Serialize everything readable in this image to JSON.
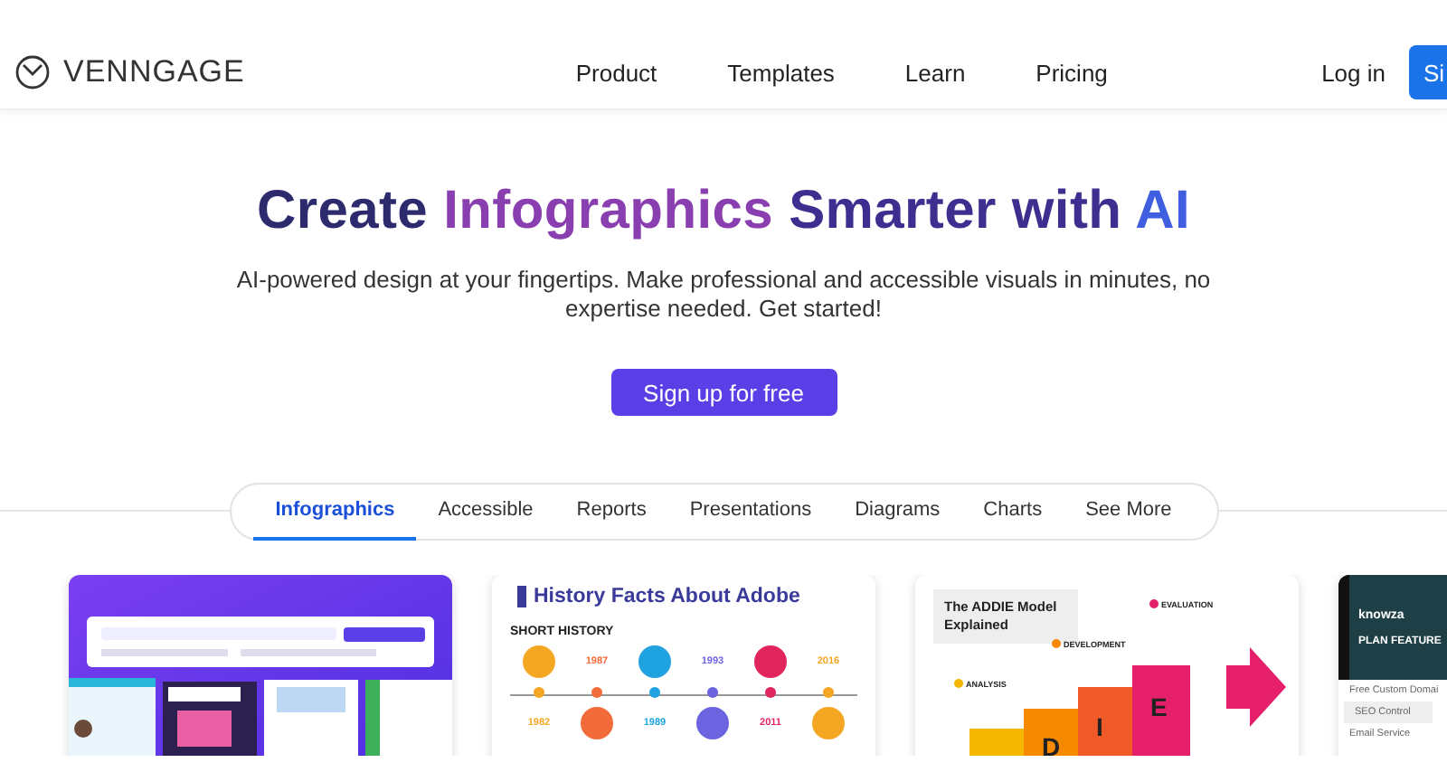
{
  "nav": {
    "logo": "VENNGAGE",
    "links": [
      "Product",
      "Templates",
      "Learn",
      "Pricing"
    ],
    "login": "Log in",
    "signup": "Si"
  },
  "hero": {
    "title": [
      {
        "text": "Create ",
        "color": "#2d2a6e"
      },
      {
        "text": "Infographics",
        "color": "#8a3fb0"
      },
      {
        "text": " Smarter with ",
        "color": "#3d2f8f"
      },
      {
        "text": "AI",
        "color": "#3f5fe0"
      }
    ],
    "subtitle": "AI-powered design at your fingertips. Make professional and accessible visuals in minutes, no expertise needed. Get started!",
    "button": "Sign up for free"
  },
  "tabs": [
    {
      "label": "Infographics",
      "selected": true
    },
    {
      "label": "Accessible",
      "selected": false
    },
    {
      "label": "Reports",
      "selected": false
    },
    {
      "label": "Presentations",
      "selected": false
    },
    {
      "label": "Diagrams",
      "selected": false
    },
    {
      "label": "Charts",
      "selected": false
    },
    {
      "label": "See More",
      "selected": false
    }
  ],
  "templates": [
    {
      "kind": "ai-builder"
    },
    {
      "kind": "timeline",
      "title": "History Facts About Adobe",
      "section": "SHORT HISTORY",
      "events": [
        {
          "year": "1982",
          "color": "#f5a623"
        },
        {
          "year": "1987",
          "color": "#f26b3a"
        },
        {
          "year": "1989",
          "color": "#1fa3e0"
        },
        {
          "year": "1993",
          "color": "#6c63e0"
        },
        {
          "year": "2011",
          "color": "#e0245e"
        },
        {
          "year": "2016",
          "color": "#f5a623"
        }
      ]
    },
    {
      "kind": "addie",
      "title": "The ADDIE Model Explained",
      "steps": [
        "ANALYSIS",
        "DEVELOPMENT",
        "EVALUATION"
      ],
      "letters": [
        "D",
        "I",
        "E"
      ]
    },
    {
      "kind": "pricing",
      "brand": "knowza",
      "header": "PLAN FEATURE",
      "rows": [
        "Free Custom Domai",
        "SEO Control",
        "Email Service"
      ]
    }
  ]
}
